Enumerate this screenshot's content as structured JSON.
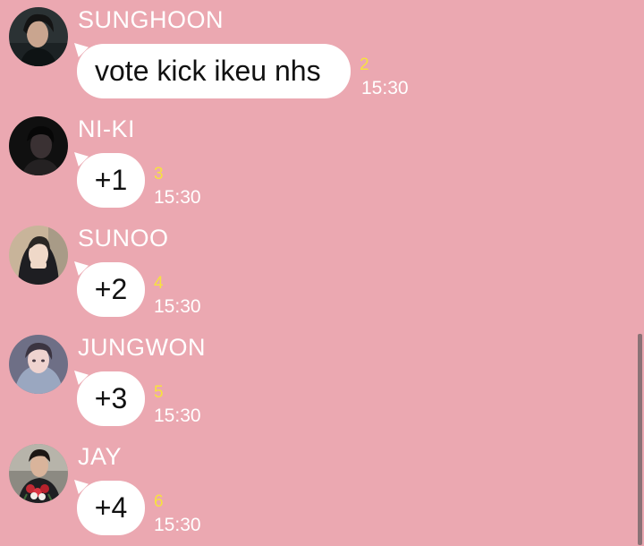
{
  "messages": [
    {
      "sender": "SUNGHOON",
      "text": "vote kick ikeu nhs",
      "unread": "2",
      "time": "15:30",
      "avatar_icon": "sunghoon-avatar"
    },
    {
      "sender": "NI-KI",
      "text": "+1",
      "unread": "3",
      "time": "15:30",
      "avatar_icon": "niki-avatar"
    },
    {
      "sender": "SUNOO",
      "text": "+2",
      "unread": "4",
      "time": "15:30",
      "avatar_icon": "sunoo-avatar"
    },
    {
      "sender": "JUNGWON",
      "text": "+3",
      "unread": "5",
      "time": "15:30",
      "avatar_icon": "jungwon-avatar"
    },
    {
      "sender": "JAY",
      "text": "+4",
      "unread": "6",
      "time": "15:30",
      "avatar_icon": "jay-avatar"
    }
  ],
  "colors": {
    "background": "#eba8b1",
    "bubble": "#ffffff",
    "unread_count": "#f7e23e",
    "sender_name": "#ffffff"
  }
}
